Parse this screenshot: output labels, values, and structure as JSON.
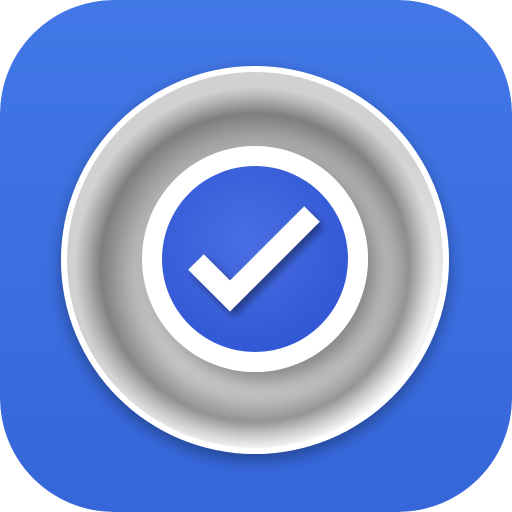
{
  "app_icon": {
    "label": "",
    "icon": "check-circle-icon",
    "colors": {
      "background": "#3b6ee0",
      "background_light": "#4a7be8",
      "disc_white": "#ffffff",
      "disc_shadow": "#8a8a8a",
      "check_circle": "#3f64dc",
      "check_mark": "#ffffff"
    }
  }
}
